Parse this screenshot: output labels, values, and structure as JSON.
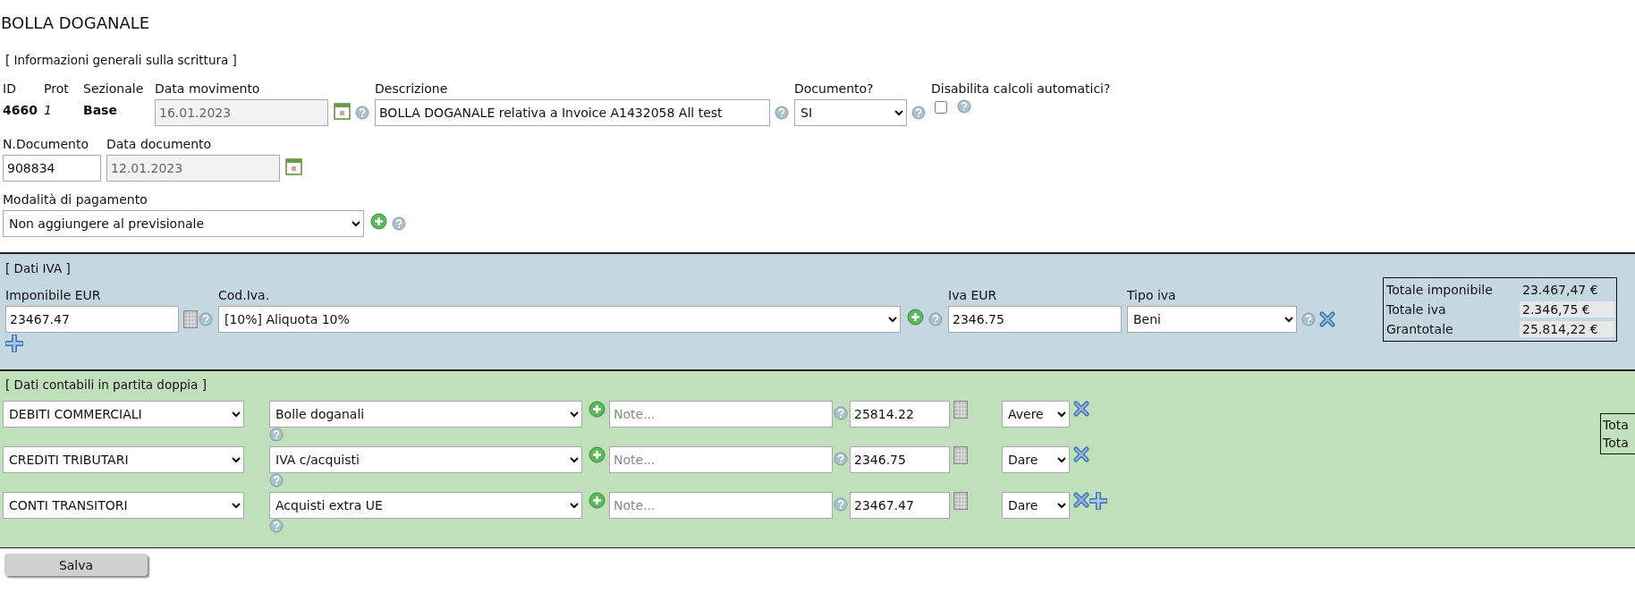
{
  "title": "BOLLA DOGANALE",
  "general": {
    "heading": "[ Informazioni generali sulla scrittura ]",
    "id": {
      "label": "ID",
      "value": "4660"
    },
    "prot": {
      "label": "Prot",
      "value": "1"
    },
    "sezionale": {
      "label": "Sezionale",
      "value": "Base"
    },
    "data_movimento": {
      "label": "Data movimento",
      "value": "16.01.2023"
    },
    "descrizione": {
      "label": "Descrizione",
      "value": "BOLLA DOGANALE relativa a Invoice A1432058 All test"
    },
    "documento": {
      "label": "Documento?",
      "value": "SI"
    },
    "disabilita": {
      "label": "Disabilita calcoli automatici?",
      "checked": false
    },
    "n_documento": {
      "label": "N.Documento",
      "value": "908834"
    },
    "data_documento": {
      "label": "Data documento",
      "value": "12.01.2023"
    },
    "modalita": {
      "label": "Modalità di pagamento",
      "value": "Non aggiungere al previsionale"
    }
  },
  "iva": {
    "heading": "[ Dati IVA ]",
    "labels": {
      "imponibile": "Imponibile EUR",
      "cod": "Cod.Iva.",
      "iva": "Iva EUR",
      "tipo": "Tipo iva"
    },
    "rows": [
      {
        "imponibile": "23467.47",
        "cod": "[10%] Aliquota 10%",
        "iva": "2346.75",
        "tipo": "Beni"
      }
    ],
    "totals": [
      {
        "label": "Totale imponibile",
        "value": "23.467,47 €"
      },
      {
        "label": "Totale iva",
        "value": "2.346,75 €"
      },
      {
        "label": "Grantotale",
        "value": "25.814,22 €"
      }
    ]
  },
  "contabili": {
    "heading": "[ Dati contabili in partita doppia ]",
    "rows": [
      {
        "conto": "DEBITI COMMERCIALI",
        "sottoconto": "Bolle doganali",
        "note_placeholder": "Note...",
        "importo": "25814.22",
        "segno": "Avere"
      },
      {
        "conto": "CREDITI TRIBUTARI",
        "sottoconto": "IVA c/acquisti",
        "note_placeholder": "Note...",
        "importo": "2346.75",
        "segno": "Dare"
      },
      {
        "conto": "CONTI TRANSITORI",
        "sottoconto": "Acquisti extra UE",
        "note_placeholder": "Note...",
        "importo": "23467.47",
        "segno": "Dare"
      }
    ],
    "totals_cut": [
      "Tota",
      "Tota"
    ]
  },
  "save_button": "Salva"
}
